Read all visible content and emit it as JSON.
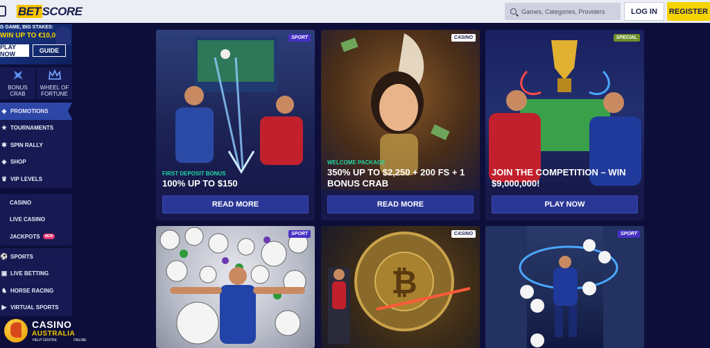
{
  "header": {
    "logo_bet": "BET",
    "logo_score": "SCORE",
    "search_placeholder": "Games, Categories, Providers",
    "login_label": "LOG IN",
    "register_label": "REGISTER"
  },
  "sidebar": {
    "promo": {
      "line1": "G GAME, BIG STAKES:",
      "line2": "WIN UP TO €10,000!",
      "play_now": "PLAY NOW",
      "guide": "GUIDE"
    },
    "tiles": [
      {
        "label": "BONUS CRAB",
        "icon": "crab-icon"
      },
      {
        "label": "WHEEL OF FORTUNE",
        "icon": "crown-icon"
      }
    ],
    "group1": [
      {
        "label": "PROMOTIONS",
        "icon": "promotions-icon",
        "active": true
      },
      {
        "label": "TOURNAMENTS",
        "icon": "trophy-icon"
      },
      {
        "label": "SPIN RALLY",
        "icon": "rally-icon"
      },
      {
        "label": "SHOP",
        "icon": "shop-icon"
      },
      {
        "label": "VIP LEVELS",
        "icon": "vip-icon"
      }
    ],
    "group2": [
      {
        "label": "CASINO"
      },
      {
        "label": "LIVE CASINO"
      },
      {
        "label": "JACKPOTS",
        "badge": "NEW"
      }
    ],
    "group3": [
      {
        "label": "SPORTS",
        "icon": "soccer-ball-icon"
      },
      {
        "label": "LIVE BETTING",
        "icon": "live-icon"
      },
      {
        "label": "HORSE RACING",
        "icon": "horse-icon"
      },
      {
        "label": "VIRTUAL SPORTS",
        "icon": "virtual-icon"
      }
    ]
  },
  "cards": [
    {
      "tag": "SPORT",
      "subtitle": "FIRST DEPOSIT BONUS",
      "title": "100% UP TO $150",
      "cta": "READ MORE"
    },
    {
      "tag": "CASINO",
      "subtitle": "WELCOME PACKAGE",
      "title": "350% UP TO $2,250 + 200 FS + 1 BONUS CRAB",
      "cta": "READ MORE"
    },
    {
      "tag": "SPECIAL",
      "subtitle": "",
      "title": "JOIN THE COMPETITION – WIN $9,000,000!",
      "cta": "PLAY NOW"
    },
    {
      "tag": "SPORT"
    },
    {
      "tag": "CASINO"
    },
    {
      "tag": "SPORT"
    }
  ],
  "watermark": {
    "line1": "CASINO",
    "line2": "AUSTRALIA",
    "line3": "HELP CENTRE",
    "line4": "ONLINE"
  },
  "colors": {
    "page_bg": "#0d0f3a",
    "accent_yellow": "#f5d400",
    "cta_blue": "#2a3796",
    "subtitle_green": "#20d9a5"
  }
}
